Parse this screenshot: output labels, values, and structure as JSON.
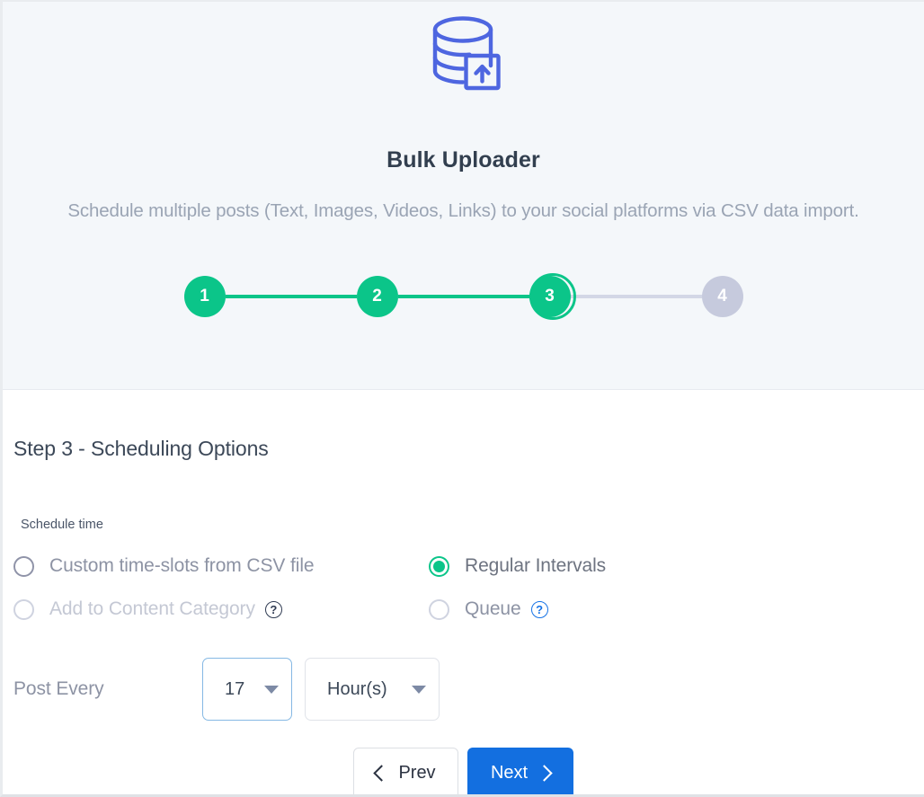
{
  "app": {
    "icon": "database-upload-icon",
    "title": "Bulk Uploader",
    "subtitle": "Schedule multiple posts (Text, Images, Videos, Links) to your social platforms via CSV data import."
  },
  "colors": {
    "accent_green": "#0bc589",
    "inactive_step": "#c6cadd",
    "primary_blue": "#136fe0",
    "icon_blue": "#4e66e0",
    "hero_bg": "#f4f7fa",
    "help_blue": "#1673e6"
  },
  "stepper": {
    "current": 3,
    "steps": [
      {
        "label": "1",
        "state": "done"
      },
      {
        "label": "2",
        "state": "done"
      },
      {
        "label": "3",
        "state": "current"
      },
      {
        "label": "4",
        "state": "todo"
      }
    ]
  },
  "main": {
    "heading": "Step 3 - Scheduling Options",
    "schedule_time": {
      "label": "Schedule time",
      "options": [
        {
          "label": "Custom time-slots from CSV file",
          "selected": false,
          "disabled": false,
          "help": false
        },
        {
          "label": "Regular Intervals",
          "selected": true,
          "disabled": false,
          "help": false
        },
        {
          "label": "Add to Content Category",
          "selected": false,
          "disabled": true,
          "help": true
        },
        {
          "label": "Queue",
          "selected": false,
          "disabled": false,
          "help": true
        }
      ],
      "help_glyph": "?"
    },
    "interval": {
      "label": "Post Every",
      "amount_value": "17",
      "unit_value": "Hour(s)"
    }
  },
  "footer": {
    "prev_label": "Prev",
    "next_label": "Next"
  }
}
